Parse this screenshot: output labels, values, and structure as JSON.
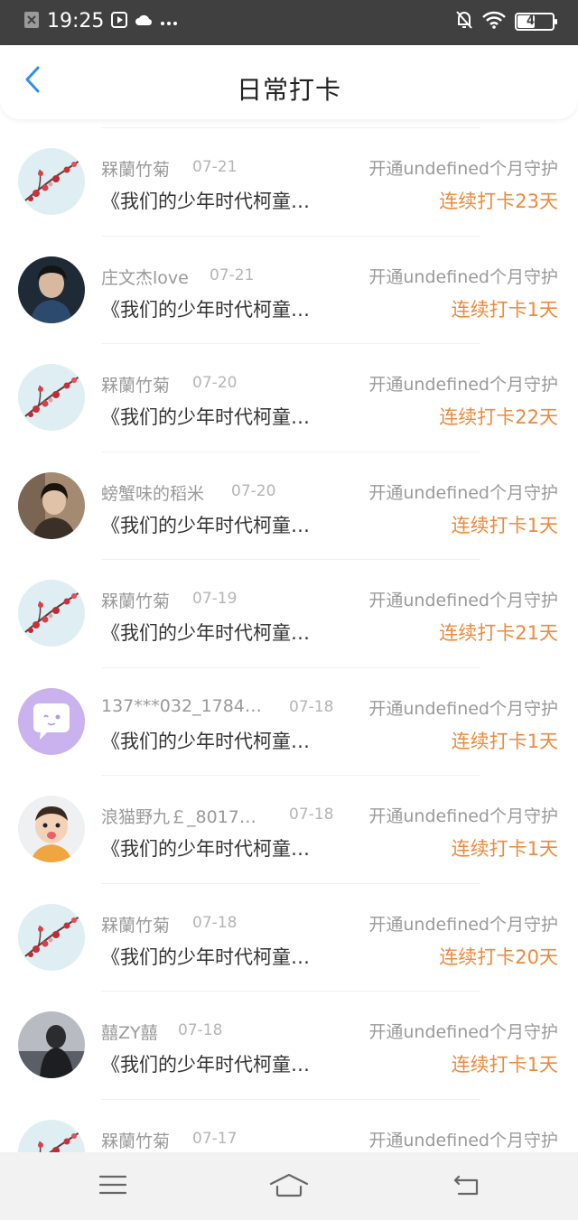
{
  "status_bar": {
    "time": "19:25",
    "battery": "49",
    "icons": [
      "close-notification-icon",
      "play-icon",
      "cloud-icon",
      "more-dots-icon",
      "mute-bell-icon",
      "wifi-icon",
      "battery-icon"
    ]
  },
  "header": {
    "title": "日常打卡",
    "back_icon": "chevron-left-icon",
    "accent_color": "#2d8fe8"
  },
  "colors": {
    "streak": "#ee8a3c",
    "muted_text": "#9a9a9a",
    "body_text": "#333333"
  },
  "rows": [
    {
      "name": "槑蘭竹菊",
      "date": "07-21",
      "guard": "开通undefined个月守护",
      "post": "《我们的少年时代柯童…",
      "streak": "连续打卡23天",
      "avatar": "plum-blossom"
    },
    {
      "name": "庄文杰love",
      "date": "07-21",
      "guard": "开通undefined个月守护",
      "post": "《我们的少年时代柯童…",
      "streak": "连续打卡1天",
      "avatar": "boy-portrait"
    },
    {
      "name": "槑蘭竹菊",
      "date": "07-20",
      "guard": "开通undefined个月守护",
      "post": "《我们的少年时代柯童…",
      "streak": "连续打卡22天",
      "avatar": "plum-blossom"
    },
    {
      "name": "螃蟹味的稻米",
      "date": "07-20",
      "guard": "开通undefined个月守护",
      "post": "《我们的少年时代柯童…",
      "streak": "连续打卡1天",
      "avatar": "youth-portrait"
    },
    {
      "name": "槑蘭竹菊",
      "date": "07-19",
      "guard": "开通undefined个月守护",
      "post": "《我们的少年时代柯童…",
      "streak": "连续打卡21天",
      "avatar": "plum-blossom"
    },
    {
      "name": "137***032_1784…",
      "date": "07-18",
      "guard": "开通undefined个月守护",
      "post": "《我们的少年时代柯童…",
      "streak": "连续打卡1天",
      "avatar": "default-chat-bubble"
    },
    {
      "name": "浪猫野九￡_8017…",
      "date": "07-18",
      "guard": "开通undefined个月守护",
      "post": "《我们的少年时代柯童…",
      "streak": "连续打卡1天",
      "avatar": "child-photo"
    },
    {
      "name": "槑蘭竹菊",
      "date": "07-18",
      "guard": "开通undefined个月守护",
      "post": "《我们的少年时代柯童…",
      "streak": "连续打卡20天",
      "avatar": "plum-blossom"
    },
    {
      "name": "囍ZY囍",
      "date": "07-18",
      "guard": "开通undefined个月守护",
      "post": "《我们的少年时代柯童…",
      "streak": "连续打卡1天",
      "avatar": "dark-figure"
    },
    {
      "name": "槑蘭竹菊",
      "date": "07-17",
      "guard": "开通undefined个月守护",
      "post": "",
      "streak": "",
      "avatar": "plum-blossom"
    }
  ],
  "nav_bar": {
    "icons": [
      "menu-icon",
      "home-icon",
      "back-icon"
    ]
  }
}
